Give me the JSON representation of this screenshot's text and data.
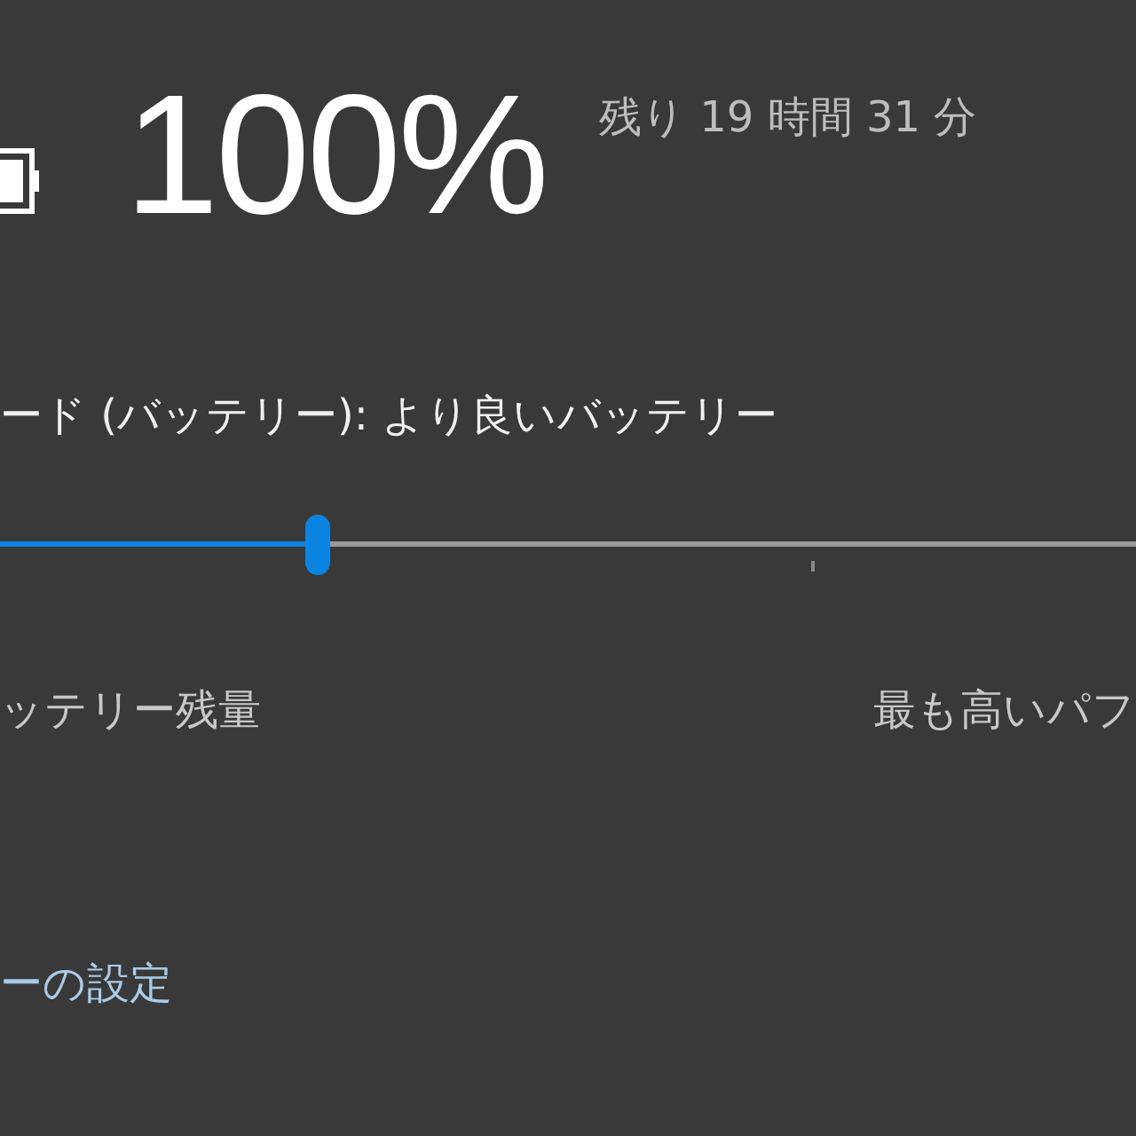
{
  "battery": {
    "percent": "100%",
    "remaining": "残り 19 時間 31 分"
  },
  "power_mode": {
    "label": "ード (バッテリー): より良いバッテリー",
    "level": 0.28,
    "min_label": "ッテリー残量",
    "max_label": "最も高いパフ"
  },
  "settings_link": "ーの設定"
}
